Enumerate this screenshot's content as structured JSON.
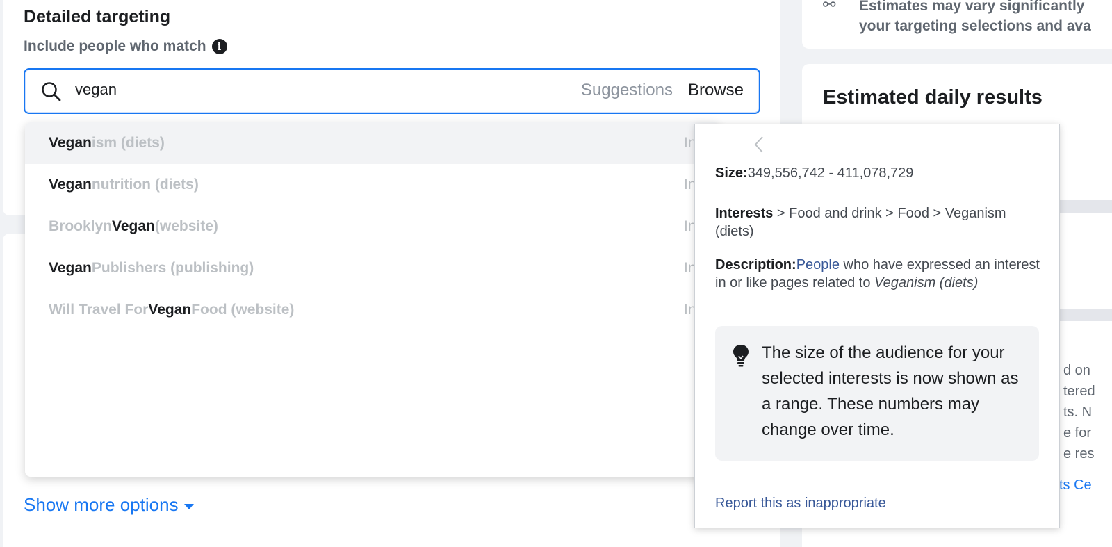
{
  "targeting": {
    "heading": "Detailed targeting",
    "subheading": "Include people who match"
  },
  "search": {
    "value": "vegan",
    "suggestions_label": "Suggestions",
    "browse_label": "Browse"
  },
  "dropdown": {
    "items": [
      {
        "pre": "",
        "bold": "Vegan",
        "post": "ism (diets)",
        "type": "In"
      },
      {
        "pre": "",
        "bold": "Vegan",
        "post": " nutrition (diets)",
        "type": "In"
      },
      {
        "pre": "Brooklyn",
        "bold": "Vegan",
        "post": " (website)",
        "type": "In"
      },
      {
        "pre": "",
        "bold": "Vegan",
        "post": " Publishers (publishing)",
        "type": "In"
      },
      {
        "pre": "Will Travel For ",
        "bold": "Vegan",
        "post": " Food (website)",
        "type": "In"
      }
    ]
  },
  "show_more": "Show more options",
  "right_panel": {
    "estimate_line1": "Estimates may vary significantly",
    "estimate_line2": "your targeting selections and ava",
    "title": "Estimated daily results",
    "faded_lines": [
      "d on",
      "tered",
      "ts. N",
      "e for",
      "e res"
    ],
    "faded_link": "ts Ce"
  },
  "popover": {
    "size_label": "Size:",
    "size_value": "349,556,742 - 411,078,729",
    "path_label": "Interests",
    "path_value": " > Food and drink > Food > Veganism (diets)",
    "desc_label": "Description:",
    "desc_link": "People",
    "desc_text": " who have expressed an interest in or like pages related to ",
    "desc_italic": "Veganism (diets)",
    "tip": "The size of the audience for your selected interests is now shown as a range. These numbers may change over time.",
    "report": "Report this as inappropriate"
  }
}
